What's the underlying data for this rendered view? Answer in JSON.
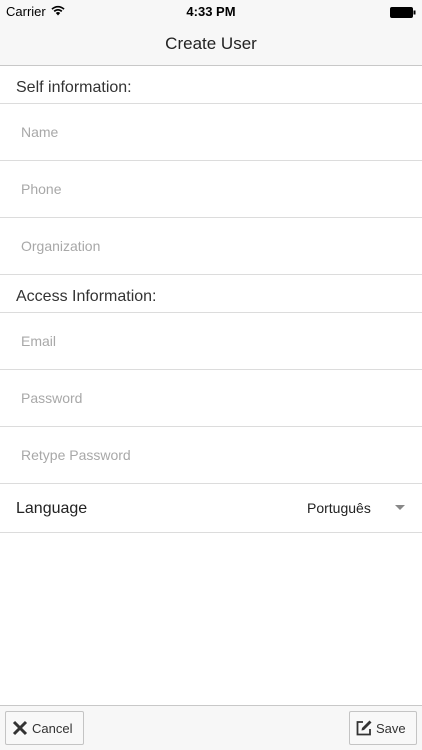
{
  "status_bar": {
    "carrier": "Carrier",
    "time": "4:33 PM"
  },
  "nav": {
    "title": "Create User"
  },
  "self_section": {
    "header": "Self information:",
    "fields": [
      {
        "placeholder": "Name",
        "value": ""
      },
      {
        "placeholder": "Phone",
        "value": ""
      },
      {
        "placeholder": "Organization",
        "value": ""
      }
    ]
  },
  "access_section": {
    "header": "Access Information:",
    "fields": [
      {
        "placeholder": "Email",
        "value": ""
      },
      {
        "placeholder": "Password",
        "value": ""
      },
      {
        "placeholder": "Retype Password",
        "value": ""
      }
    ]
  },
  "language": {
    "label": "Language",
    "selected": "Português"
  },
  "toolbar": {
    "cancel_label": "Cancel",
    "save_label": "Save"
  },
  "icons": {
    "wifi": "wifi-icon",
    "battery": "battery-icon",
    "cancel": "close-icon",
    "save": "edit-icon",
    "dropdown": "caret-down-icon"
  }
}
